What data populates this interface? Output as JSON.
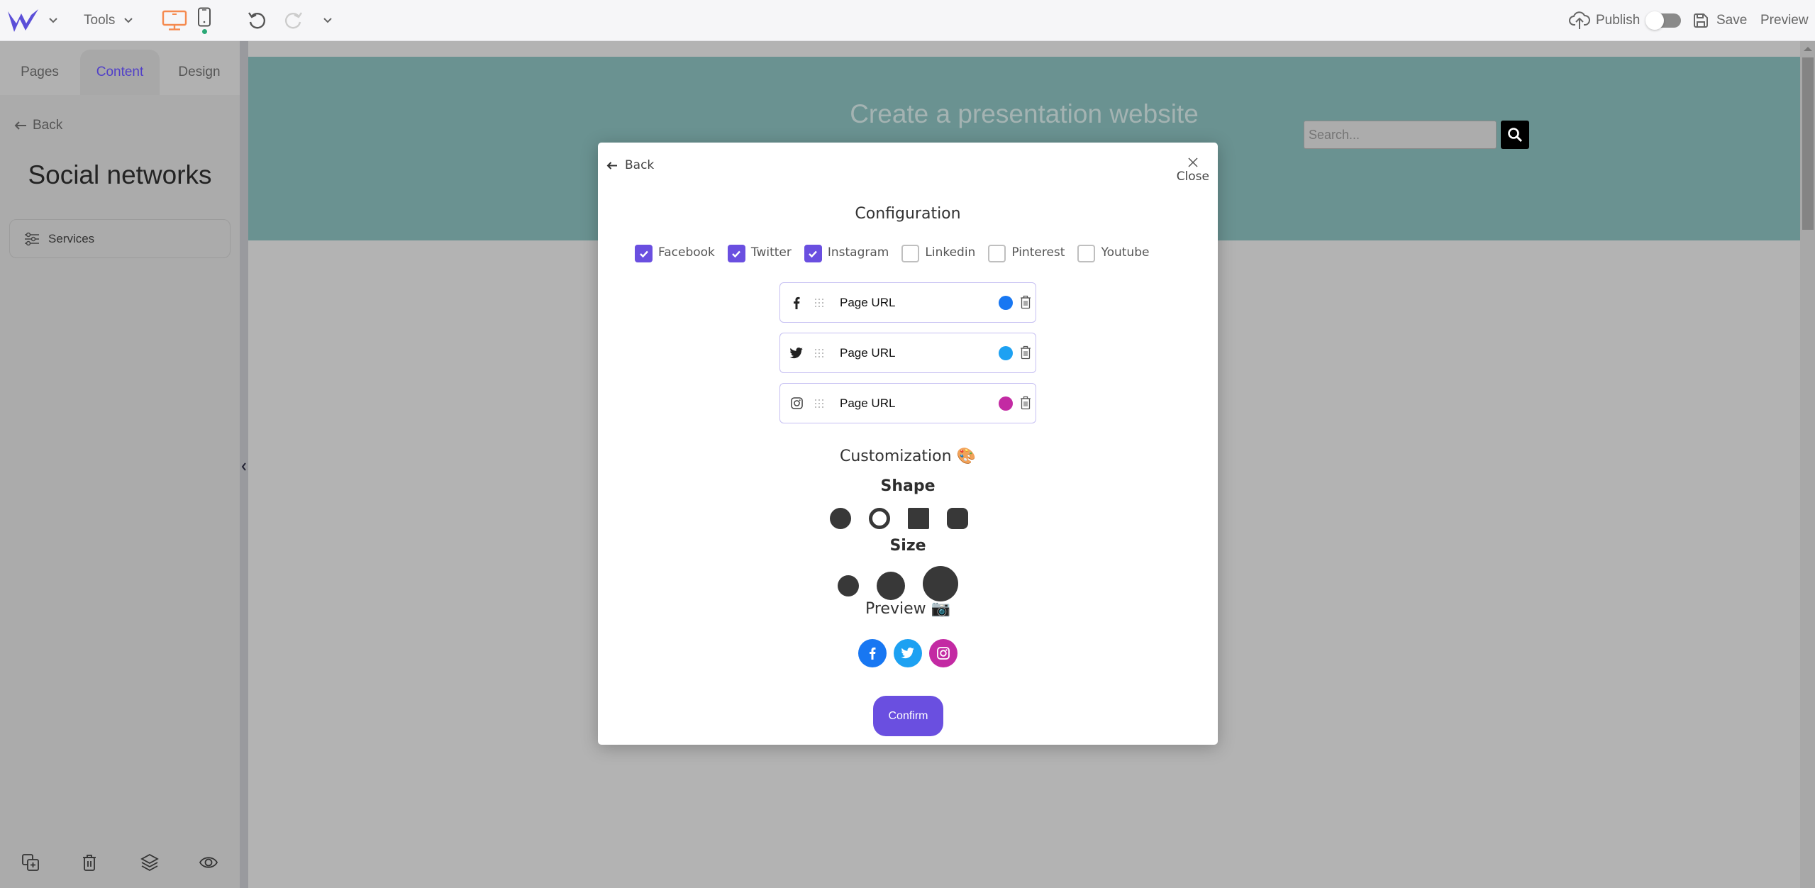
{
  "topbar": {
    "tools_label": "Tools",
    "publish_label": "Publish",
    "publish_enabled": false,
    "save_label": "Save",
    "preview_label": "Preview",
    "colors": {
      "brand": "#5b4fd8",
      "desktop_active": "#f58a4f",
      "mobile_dot": "#2aa876"
    }
  },
  "sidebar": {
    "tabs": [
      {
        "label": "Pages",
        "active": false
      },
      {
        "label": "Content",
        "active": true
      },
      {
        "label": "Design",
        "active": false
      }
    ],
    "back_label": "Back",
    "title": "Social networks",
    "items": [
      {
        "label": "Services",
        "icon": "sliders-icon"
      }
    ],
    "bottom_icons": [
      "duplicate-icon",
      "trash-icon",
      "layers-icon",
      "eye-icon"
    ]
  },
  "canvas": {
    "banner_title": "Create a presentation website",
    "search_placeholder": "Search..."
  },
  "modal": {
    "back_label": "Back",
    "close_label": "Close",
    "configuration_title": "Configuration",
    "networks": [
      {
        "label": "Facebook",
        "checked": true
      },
      {
        "label": "Twitter",
        "checked": true
      },
      {
        "label": "Instagram",
        "checked": true
      },
      {
        "label": "Linkedin",
        "checked": false
      },
      {
        "label": "Pinterest",
        "checked": false
      },
      {
        "label": "Youtube",
        "checked": false
      }
    ],
    "rows": [
      {
        "network": "facebook",
        "icon": "facebook-icon",
        "placeholder": "Page URL",
        "color": "#1877f2"
      },
      {
        "network": "twitter",
        "icon": "twitter-icon",
        "placeholder": "Page URL",
        "color": "#1da1f2"
      },
      {
        "network": "instagram",
        "icon": "instagram-icon",
        "placeholder": "Page URL",
        "color": "#c32aa3"
      }
    ],
    "customization_title": "Customization",
    "customization_emoji": "🎨",
    "shape_title": "Shape",
    "shapes": [
      "circle",
      "ring",
      "square",
      "rounded-square"
    ],
    "size_title": "Size",
    "sizes": [
      "small",
      "medium",
      "large"
    ],
    "preview_title": "Preview",
    "preview_emoji": "📷",
    "confirm_label": "Confirm",
    "accent": "#6a4fe0"
  }
}
